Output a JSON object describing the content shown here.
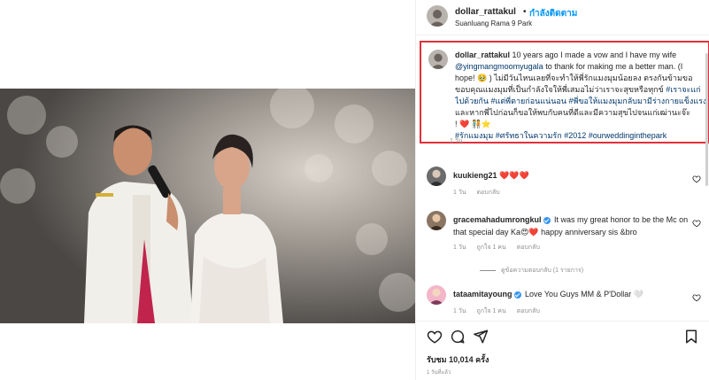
{
  "post": {
    "username": "dollar_rattakul",
    "separator": "•",
    "follow_label": "กำลังติดตาม",
    "location": "Suanluang Rama 9 Park"
  },
  "caption": {
    "username": "dollar_rattakul",
    "line1": "10 years ago I made a vow and I have my wife",
    "mention": "@yingmangmoomyugala",
    "line2_rest": " to thank for making me a better man. (I",
    "line3": "hope! 🥹 ) ไม่มีวันไหนเลยที่จะทำให้พี่รักแมงมุมน้อยลง ตรงกันข้ามขอ",
    "line4": "ขอบคุณแมงมุมที่เป็นกำลังใจให้พี่เสมอไม่ว่าเราจะสุขหรือทุกข์",
    "tag1": " #เราจะแก่",
    "tag1b": "ไปด้วยกัน",
    "tag2": " #แต่พี่ตายก่อนแน่นอน",
    "tag3": " #พี่ขอให้แมงมุมกลับมามีร่างกายแข็งแรง",
    "line6": "และหากพี่ไปก่อนก็ขอให้พบกับคนที่ดีและมีความสุขไปจนแก่เฒ่านะจ๊ะ",
    "line7": "! ❤️ 🧑‍🤝‍🧑⭐",
    "hashtags": "#รักแมงมุม #ศรัทธาในความรัก #2012 #ourweddinginthepark",
    "time": "1 วัน"
  },
  "comments": [
    {
      "username": "kuukieng21",
      "text": "❤️❤️❤️",
      "time": "1 วัน",
      "reply": "ตอบกลับ",
      "likes": ""
    },
    {
      "username": "gracemahadumrongkul",
      "text": "It was my great honor to be the Mc on that special day Ka😍❤️ happy anniversary sis &bro",
      "time": "1 วัน",
      "likes": "ถูกใจ 1 คน",
      "reply": "ตอบกลับ"
    },
    {
      "username": "tataamitayoung",
      "text": "Love You Guys MM & P'Dollar 🤍",
      "time": "1 วัน",
      "likes": "ถูกใจ 1 คน",
      "reply": "ตอบกลับ"
    }
  ],
  "view_replies": "ดูข้อความตอบกลับ (1 รายการ)",
  "actions": {
    "views": "รับชม 10,014 ครั้ง",
    "post_time": "1 วันที่แล้ว"
  },
  "icons": {
    "like": "heart-icon",
    "comment": "comment-icon",
    "share": "paper-plane-icon",
    "save": "bookmark-icon"
  },
  "colors": {
    "link": "#00376b",
    "follow": "#0095f6",
    "highlight_border": "#e0313a",
    "verified": "#3897f0"
  }
}
